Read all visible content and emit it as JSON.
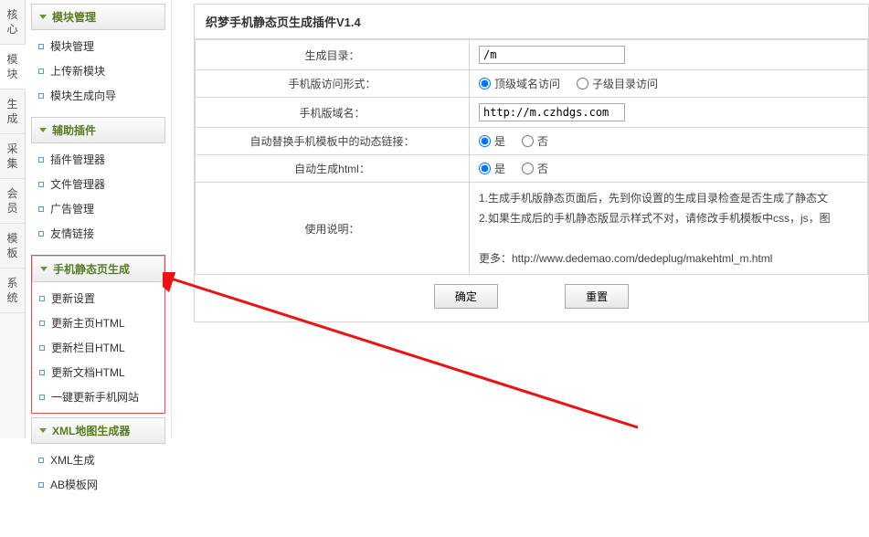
{
  "vtabs": [
    "核心",
    "模块",
    "生成",
    "采集",
    "会员",
    "模板",
    "系统"
  ],
  "sidebar": [
    {
      "title": "模块管理",
      "items": [
        "模块管理",
        "上传新模块",
        "模块生成向导"
      ],
      "highlight": false
    },
    {
      "title": "辅助插件",
      "items": [
        "插件管理器",
        "文件管理器",
        "广告管理",
        "友情链接"
      ],
      "highlight": false
    },
    {
      "title": "手机静态页生成",
      "items": [
        "更新设置",
        "更新主页HTML",
        "更新栏目HTML",
        "更新文档HTML",
        "一键更新手机网站"
      ],
      "highlight": true
    },
    {
      "title": "XML地图生成器",
      "items": [
        "XML生成",
        "AB模板网"
      ],
      "highlight": false
    }
  ],
  "panel": {
    "title": "织梦手机静态页生成插件V1.4",
    "rows": {
      "out_dir_label": "生成目录：",
      "out_dir_value": "/m",
      "visit_type_label": "手机版访问形式：",
      "visit_type_opt1": "顶级域名访问",
      "visit_type_opt2": "子级目录访问",
      "domain_label": "手机版域名：",
      "domain_value": "http://m.czhdgs.com",
      "replace_label": "自动替换手机模板中的动态链接：",
      "yes": "是",
      "no": "否",
      "auto_html_label": "自动生成html：",
      "usage_label": "使用说明：",
      "usage_line1": "1.生成手机版静态页面后，先到你设置的生成目录检查是否生成了静态文",
      "usage_line2": "2.如果生成后的手机静态版显示样式不对，请修改手机模板中css，js，图",
      "usage_more": "更多：http://www.dedemao.com/dedeplug/makehtml_m.html"
    },
    "buttons": {
      "ok": "确定",
      "reset": "重置"
    }
  }
}
